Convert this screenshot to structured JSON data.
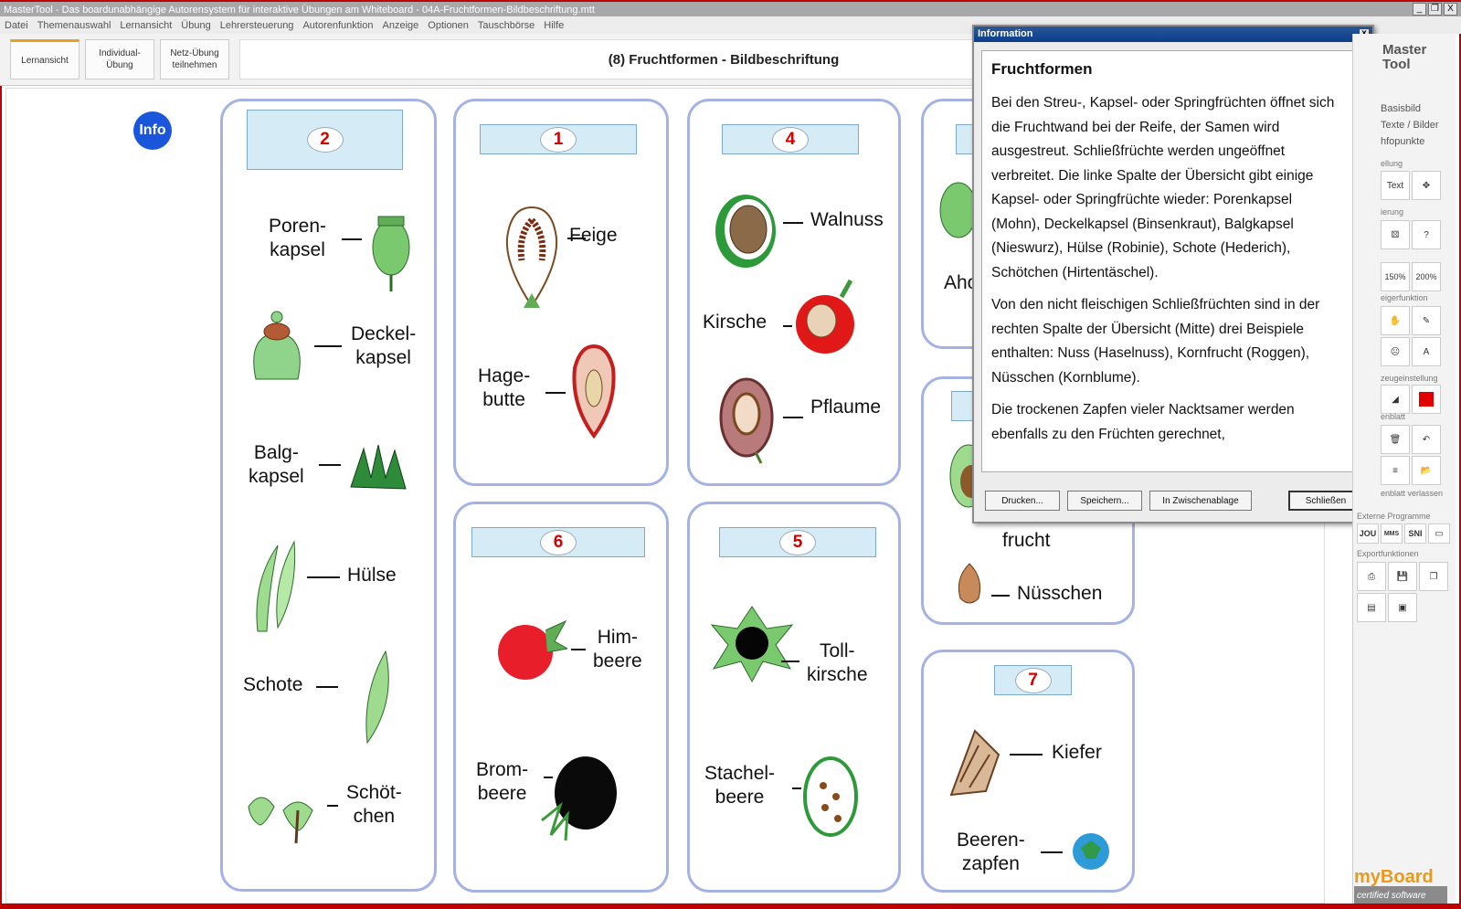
{
  "window": {
    "title": "MasterTool - Das boardunabhängige Autorensystem für interaktive Übungen am Whiteboard - 04A-Fruchtformen-Bildbeschriftung.mtt",
    "controls": [
      "_",
      "❐",
      "X"
    ]
  },
  "menu": [
    "Datei",
    "Themenauswahl",
    "Lernansicht",
    "Übung",
    "Lehrersteuerung",
    "Autorenfunktion",
    "Anzeige",
    "Optionen",
    "Tauschbörse",
    "Hilfe"
  ],
  "toolbar": {
    "buttons": [
      "Lernansicht",
      "Individual-\nÜbung",
      "Netz-Übung\nteilnehmen"
    ],
    "exercise_title": "(8) Fruchtformen - Bildbeschriftung"
  },
  "info_label": "Info",
  "cards": {
    "c2": {
      "num": "2",
      "words": [
        "Poren-\nkapsel",
        "Deckel-\nkapsel",
        "Balg-\nkapsel",
        "Hülse",
        "Schote",
        "Schöt-\nchen"
      ]
    },
    "c1": {
      "num": "1",
      "words": [
        "Feige",
        "Hage-\nbutte"
      ]
    },
    "c4": {
      "num": "4",
      "words": [
        "Walnuss",
        "Kirsche",
        "Pflaume"
      ]
    },
    "c3": {
      "words": [
        "Aho"
      ]
    },
    "c8": {
      "words": [
        "frucht",
        "Nüsschen"
      ]
    },
    "c6": {
      "num": "6",
      "words": [
        "Him-\nbeere",
        "Brom-\nbeere"
      ]
    },
    "c5": {
      "num": "5",
      "words": [
        "Toll-\nkirsche",
        "Stachel-\nbeere"
      ]
    },
    "c7": {
      "num": "7",
      "words": [
        "Kiefer",
        "Beeren-\nzapfen"
      ]
    }
  },
  "dialog": {
    "title": "Information",
    "close": "x",
    "heading": "Fruchtformen",
    "paragraphs": [
      "Bei den Streu-, Kapsel- oder Springfrüchten öffnet sich die Fruchtwand bei der Reife, der Samen wird ausgestreut. Schließfrüchte werden ungeöffnet verbreitet. Die linke Spalte der Übersicht gibt einige Kapsel- oder Springfrüchte wieder: Porenkapsel (Mohn), Deckelkapsel (Binsenkraut), Balgkapsel (Nieswurz), Hülse (Robinie), Schote (Hederich), Schötchen (Hirtentäschel).",
      "Von den nicht fleischigen Schließfrüchten sind in der rechten Spalte der Übersicht (Mitte) drei Beispiele enthalten: Nuss (Haselnuss), Kornfrucht (Roggen), Nüsschen (Kornblume).",
      "Die trockenen Zapfen vieler Nacktsamer werden ebenfalls zu den Früchten gerechnet,"
    ],
    "buttons": [
      "Drucken...",
      "Speichern...",
      "In Zwischenablage",
      "Schließen"
    ]
  },
  "right_panel": {
    "logo": "Master\nTool",
    "items": [
      "Basisbild",
      "Texte / Bilder",
      "hfopunkte"
    ],
    "sections": [
      "ellung",
      "ierung",
      "eigerfunktion",
      "zeugeinstellung",
      "enblatt",
      "enblatt verlassen",
      "Externe Programme",
      "Exportfunktionen"
    ],
    "text_btn": "Text",
    "zoom": [
      "150%",
      "200%"
    ],
    "ext": [
      "JOU",
      "MMS",
      "SNI"
    ],
    "color_red": "#e00000",
    "brand": "myBoard",
    "cert": "certified software"
  }
}
